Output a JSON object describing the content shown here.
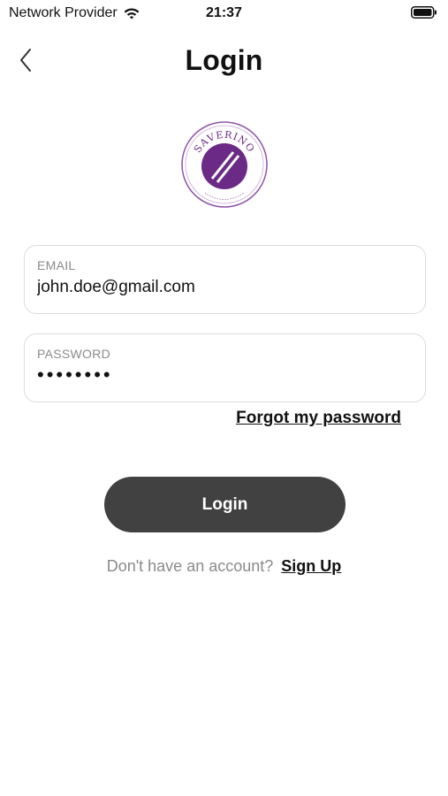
{
  "status_bar": {
    "carrier": "Network Provider",
    "time": "21:37",
    "icons": [
      "wifi-icon",
      "battery-icon"
    ]
  },
  "header": {
    "back_icon": "chevron-left-icon",
    "title": "Login"
  },
  "logo": {
    "brand": "SAVERINO",
    "colors": {
      "primary": "#6b2a86",
      "ring": "#8e55a8"
    }
  },
  "form": {
    "email": {
      "label": "EMAIL",
      "value": "john.doe@gmail.com"
    },
    "password": {
      "label": "PASSWORD",
      "value": "••••••••"
    },
    "forgot_label": "Forgot my password",
    "submit_label": "Login"
  },
  "signup": {
    "prompt": "Don't have an account?",
    "link_label": "Sign Up"
  },
  "colors": {
    "button": "#414141",
    "muted_text": "#8a8a8a",
    "border": "#dcdcdc"
  }
}
